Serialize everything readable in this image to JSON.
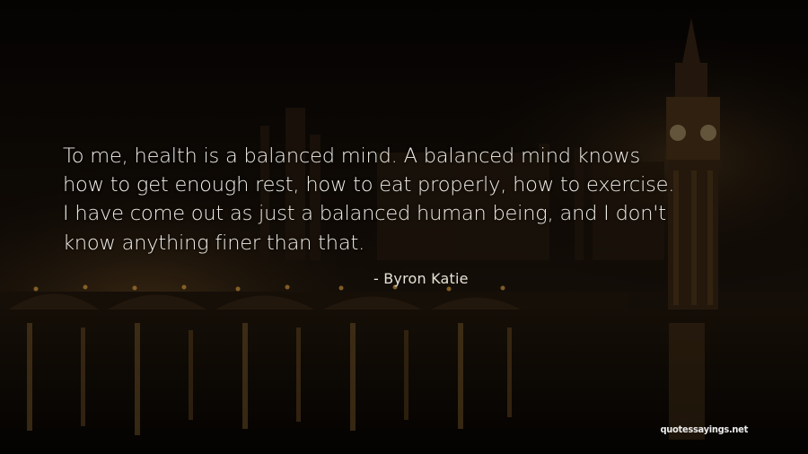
{
  "quote": {
    "lines": [
      "To me, health is a balanced mind. A balanced mind knows",
      "how to get enough rest, how to eat properly, how to exercise.",
      "I have come out as just a balanced human being, and I don't",
      "know anything finer than that."
    ]
  },
  "author": "- Byron Katie",
  "watermark": "quotessayings.net",
  "colors": {
    "text": "#f1efe8",
    "background": "#0b0806",
    "light_glow": "#c9913c"
  }
}
